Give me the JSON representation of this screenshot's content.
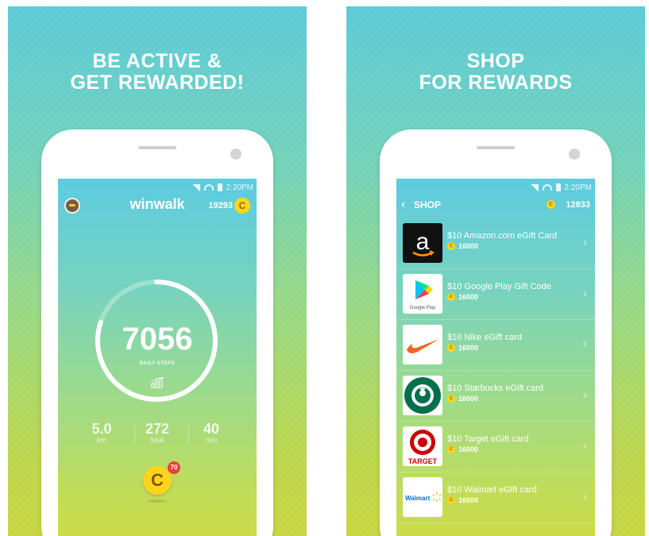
{
  "left": {
    "headline": [
      "BE ACTIVE &",
      "GET REWARDED!"
    ],
    "status_time": "2:20PM",
    "brand": "winwalk",
    "coins": "19293",
    "coin_letter": "C",
    "steps": "7056",
    "steps_label": "DAILY STEPS",
    "stats": [
      {
        "value": "5.0",
        "unit": "km"
      },
      {
        "value": "272",
        "unit": "kcal"
      },
      {
        "value": "40",
        "unit": "min"
      }
    ],
    "claim_letter": "C",
    "claim_badge": "70",
    "progress_fraction": 0.8
  },
  "right": {
    "headline": [
      "SHOP",
      "FOR REWARDS"
    ],
    "status_time": "2:20PM",
    "title": "SHOP",
    "coins": "12833",
    "coin_letter": "C",
    "items": [
      {
        "title": "$10 Amazon.com eGift Card",
        "price": "16000",
        "logo": "amazon-logo"
      },
      {
        "title": "$10 Google Play Gift Code",
        "price": "16000",
        "logo": "google-play-logo",
        "logo_text": "Google Play"
      },
      {
        "title": "$10 Nike eGift card",
        "price": "16000",
        "logo": "nike-logo"
      },
      {
        "title": "$10 Starbucks eGift card",
        "price": "16000",
        "logo": "starbucks-logo"
      },
      {
        "title": "$10 Target eGift card",
        "price": "16000",
        "logo": "target-logo",
        "logo_text": "TARGET"
      },
      {
        "title": "$10 Walmart eGift card",
        "price": "16000",
        "logo": "walmart-logo",
        "logo_text": "Walmart"
      }
    ]
  },
  "colors": {
    "accent_coin": "#ffd41f",
    "badge_red": "#e8423a",
    "gradient_top": "#5ccad8",
    "gradient_bottom": "#c7d640"
  }
}
